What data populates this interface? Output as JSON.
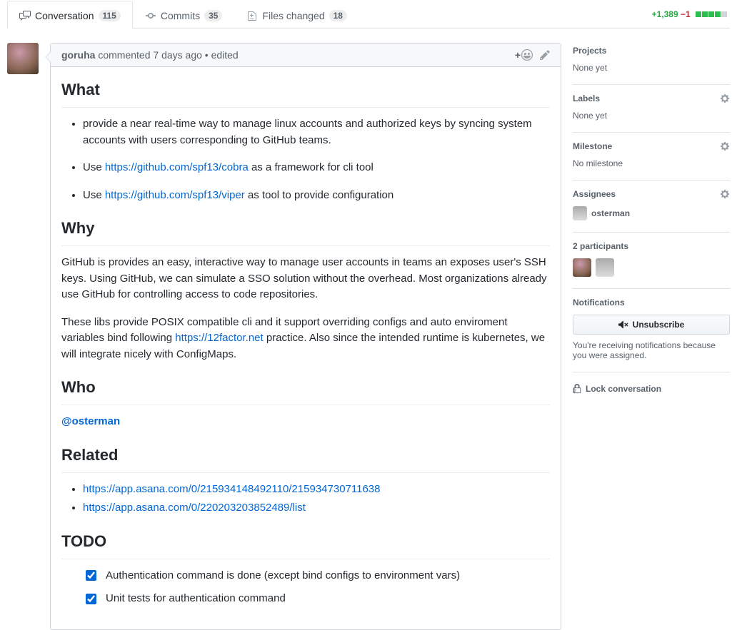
{
  "tabs": {
    "conversation": {
      "label": "Conversation",
      "count": "115"
    },
    "commits": {
      "label": "Commits",
      "count": "35"
    },
    "files": {
      "label": "Files changed",
      "count": "18"
    }
  },
  "diffstat": {
    "additions": "+1,389",
    "deletions": "−1"
  },
  "comment": {
    "author": "goruha",
    "meta_prefix": " commented ",
    "time": "7 days ago",
    "edited_suffix": " • edited",
    "h_what": "What",
    "what_item1": "provide a near real-time way to manage linux accounts and authorized keys by syncing system accounts with users corresponding to GitHub teams.",
    "what_item2_prefix": "Use ",
    "what_item2_link": "https://github.com/spf13/cobra",
    "what_item2_suffix": " as a framework for cli tool",
    "what_item3_prefix": "Use ",
    "what_item3_link": "https://github.com/spf13/viper",
    "what_item3_suffix": " as tool to provide configuration",
    "h_why": "Why",
    "why_p1": "GitHub is provides an easy, interactive way to manage user accounts in teams an exposes user's SSH keys. Using GitHub, we can simulate a SSO solution without the overhead. Most organizations already use GitHub for controlling access to code repositories.",
    "why_p2_prefix": "These libs provide POSIX compatible cli and it support overriding configs and auto enviroment variables bind following ",
    "why_p2_link": "https://12factor.net",
    "why_p2_suffix": " practice. Also since the intended runtime is kubernetes, we will integrate nicely with ConfigMaps.",
    "h_who": "Who",
    "who_mention": "@osterman",
    "h_related": "Related",
    "related_link1": "https://app.asana.com/0/215934148492110/215934730711638",
    "related_link2": "https://app.asana.com/0/220203203852489/list",
    "h_todo": "TODO",
    "todo1": "Authentication command is done (except bind configs to environment vars)",
    "todo2": "Unit tests for authentication command"
  },
  "sidebar": {
    "projects_title": "Projects",
    "projects_val": "None yet",
    "labels_title": "Labels",
    "labels_val": "None yet",
    "milestone_title": "Milestone",
    "milestone_val": "No milestone",
    "assignees_title": "Assignees",
    "assignee_name": "osterman",
    "participants_title": "2 participants",
    "notifications_title": "Notifications",
    "unsubscribe_label": "Unsubscribe",
    "notif_reason": "You're receiving notifications because you were assigned.",
    "lock_label": "Lock conversation"
  }
}
